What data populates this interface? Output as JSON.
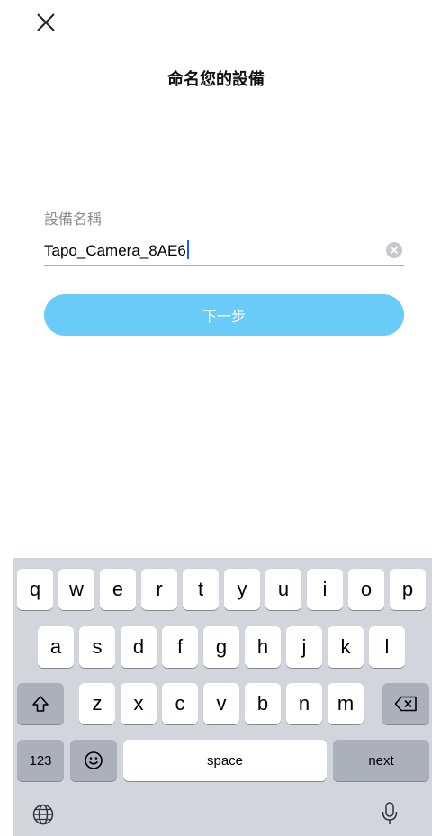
{
  "header": {
    "close_icon": "close-icon",
    "title": "命名您的設備"
  },
  "form": {
    "label": "設備名稱",
    "value": "Tapo_Camera_8AE6",
    "clear_icon": "clear-icon",
    "next_label": "下一步",
    "accent_color": "#5ec8f8"
  },
  "keyboard": {
    "row1": [
      "q",
      "w",
      "e",
      "r",
      "t",
      "y",
      "u",
      "i",
      "o",
      "p"
    ],
    "row2": [
      "a",
      "s",
      "d",
      "f",
      "g",
      "h",
      "j",
      "k",
      "l"
    ],
    "row3": [
      "z",
      "x",
      "c",
      "v",
      "b",
      "n",
      "m"
    ],
    "shift_icon": "shift-icon",
    "delete_icon": "delete-icon",
    "numbers_label": "123",
    "emoji_icon": "emoji-icon",
    "space_label": "space",
    "return_label": "next",
    "globe_icon": "globe-icon",
    "mic_icon": "microphone-icon"
  }
}
